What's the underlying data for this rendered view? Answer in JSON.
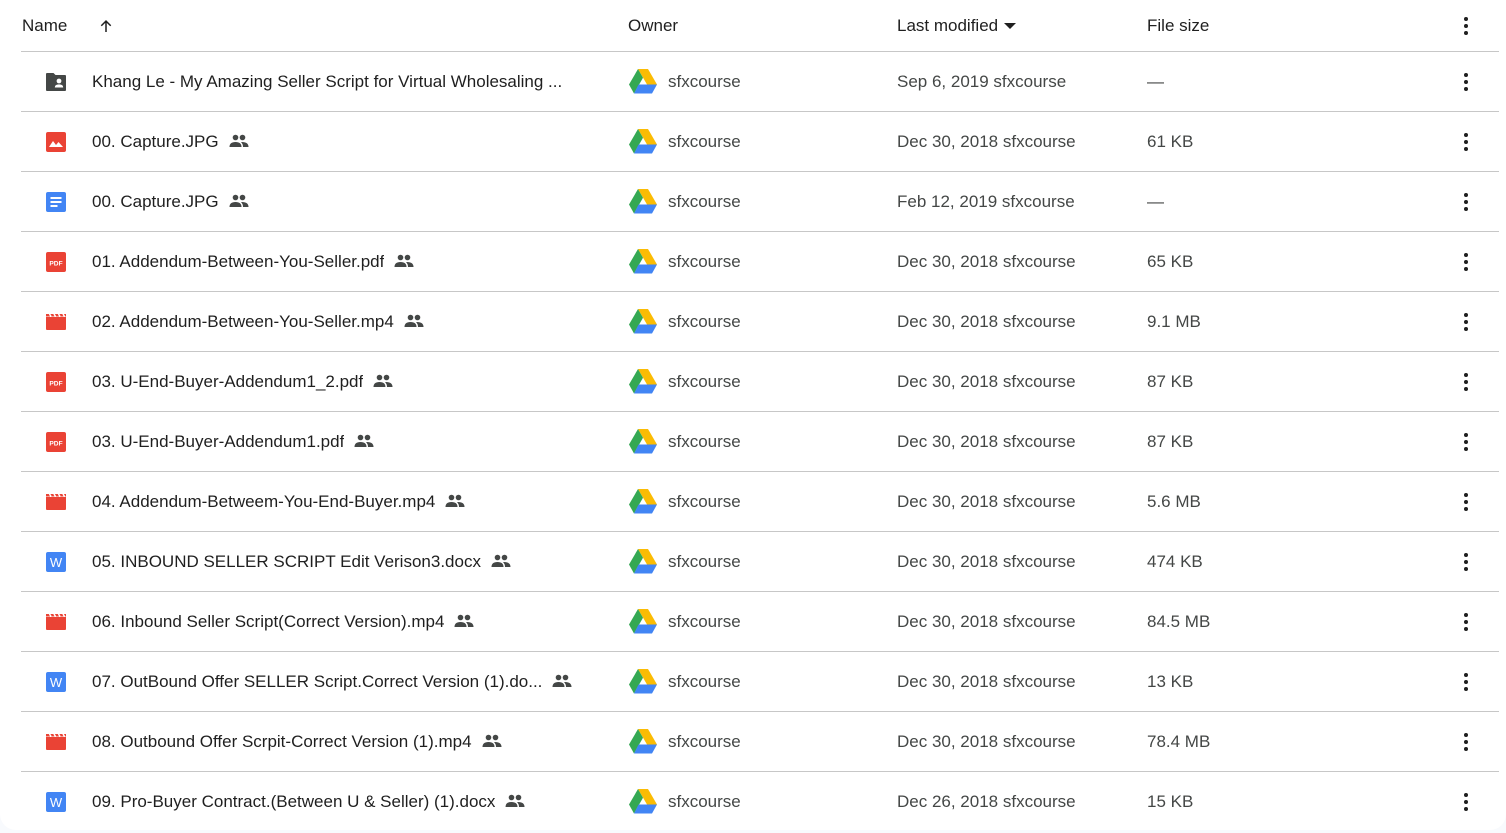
{
  "header": {
    "name": "Name",
    "sort_direction": "ascending",
    "owner": "Owner",
    "last_modified": "Last modified",
    "file_size": "File size",
    "more_actions_icon": "more-vert-icon"
  },
  "files": [
    {
      "type": "shared-folder",
      "icon": "shared-folder-icon",
      "name": "Khang Le - My Amazing Seller Script for Virtual Wholesaling ...",
      "shared": false,
      "owner": "sfxcourse",
      "modified": "Sep 6, 2019 sfxcourse",
      "size": "—"
    },
    {
      "type": "image",
      "icon": "image-icon",
      "name": "00. Capture.JPG",
      "shared": true,
      "owner": "sfxcourse",
      "modified": "Dec 30, 2018 sfxcourse",
      "size": "61 KB"
    },
    {
      "type": "google-doc",
      "icon": "google-docs-icon",
      "name": "00. Capture.JPG",
      "shared": true,
      "owner": "sfxcourse",
      "modified": "Feb 12, 2019 sfxcourse",
      "size": "—"
    },
    {
      "type": "pdf",
      "icon": "pdf-icon",
      "name": "01. Addendum-Between-You-Seller.pdf",
      "shared": true,
      "owner": "sfxcourse",
      "modified": "Dec 30, 2018 sfxcourse",
      "size": "65 KB"
    },
    {
      "type": "video",
      "icon": "video-icon",
      "name": "02. Addendum-Between-You-Seller.mp4",
      "shared": true,
      "owner": "sfxcourse",
      "modified": "Dec 30, 2018 sfxcourse",
      "size": "9.1 MB"
    },
    {
      "type": "pdf",
      "icon": "pdf-icon",
      "name": "03. U-End-Buyer-Addendum1_2.pdf",
      "shared": true,
      "owner": "sfxcourse",
      "modified": "Dec 30, 2018 sfxcourse",
      "size": "87 KB"
    },
    {
      "type": "pdf",
      "icon": "pdf-icon",
      "name": "03. U-End-Buyer-Addendum1.pdf",
      "shared": true,
      "owner": "sfxcourse",
      "modified": "Dec 30, 2018 sfxcourse",
      "size": "87 KB"
    },
    {
      "type": "video",
      "icon": "video-icon",
      "name": "04. Addendum-Betweem-You-End-Buyer.mp4",
      "shared": true,
      "owner": "sfxcourse",
      "modified": "Dec 30, 2018 sfxcourse",
      "size": "5.6 MB"
    },
    {
      "type": "word",
      "icon": "word-icon",
      "name": "05. INBOUND SELLER SCRIPT Edit Verison3.docx",
      "shared": true,
      "owner": "sfxcourse",
      "modified": "Dec 30, 2018 sfxcourse",
      "size": "474 KB"
    },
    {
      "type": "video",
      "icon": "video-icon",
      "name": "06. Inbound Seller Script(Correct Version).mp4",
      "shared": true,
      "owner": "sfxcourse",
      "modified": "Dec 30, 2018 sfxcourse",
      "size": "84.5 MB"
    },
    {
      "type": "word",
      "icon": "word-icon",
      "name": "07. OutBound Offer SELLER Script.Correct Version (1).do...",
      "shared": true,
      "owner": "sfxcourse",
      "modified": "Dec 30, 2018 sfxcourse",
      "size": "13 KB"
    },
    {
      "type": "video",
      "icon": "video-icon",
      "name": "08. Outbound Offer Scrpit-Correct Version (1).mp4",
      "shared": true,
      "owner": "sfxcourse",
      "modified": "Dec 30, 2018 sfxcourse",
      "size": "78.4 MB"
    },
    {
      "type": "word",
      "icon": "word-icon",
      "name": "09. Pro-Buyer Contract.(Between U & Seller) (1).docx",
      "shared": true,
      "owner": "sfxcourse",
      "modified": "Dec 26, 2018 sfxcourse",
      "size": "15 KB"
    }
  ],
  "colors": {
    "red_icon": "#ea4335",
    "blue_icon": "#4285f4",
    "folder_icon": "#444746",
    "divider": "#c7c7c7",
    "page_bg": "#f8fafd",
    "drive_green": "#34a853",
    "drive_yellow": "#fbbc04",
    "drive_blue": "#4285f4"
  }
}
